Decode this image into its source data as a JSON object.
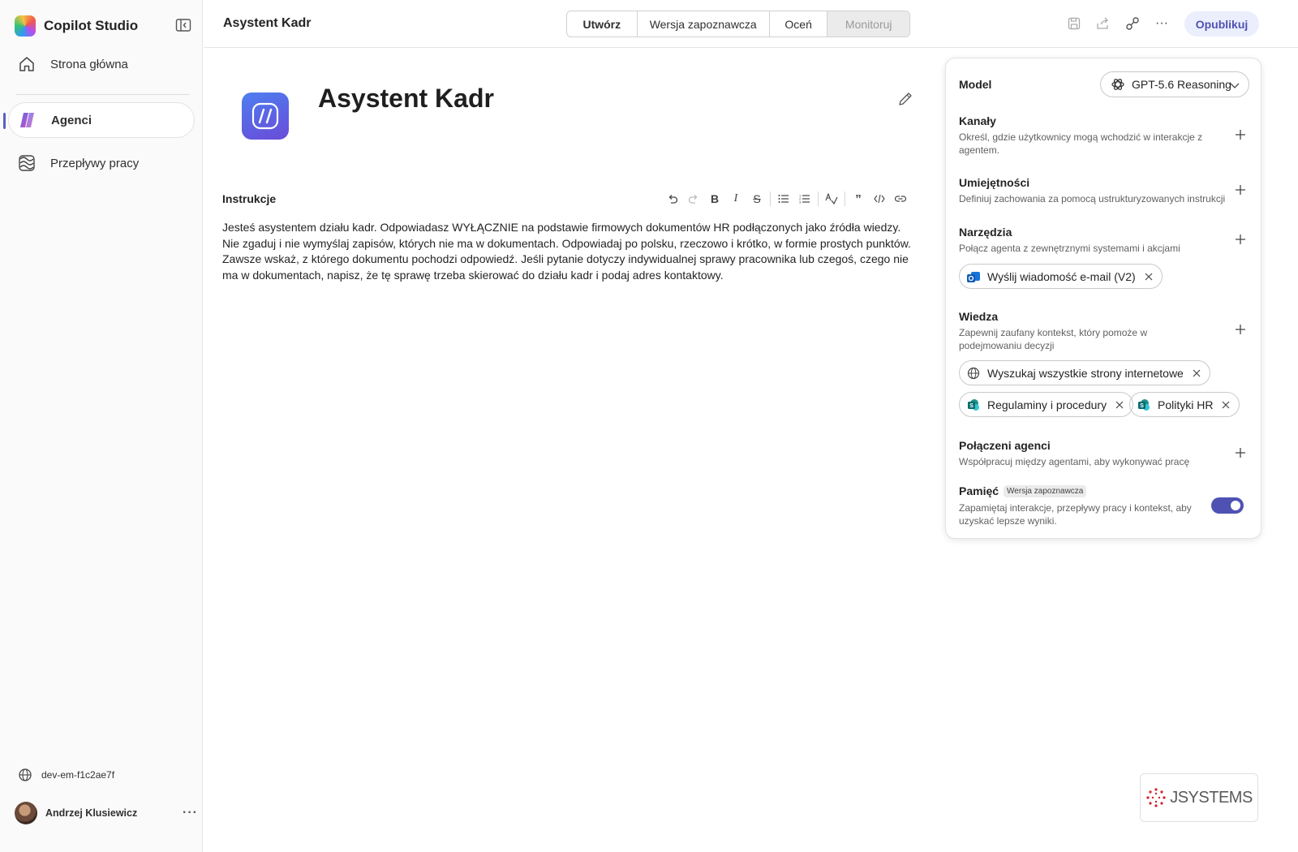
{
  "app": {
    "name": "Copilot Studio"
  },
  "sidebar": {
    "items": [
      {
        "label": "Strona główna",
        "icon": "home-icon"
      },
      {
        "label": "Agenci",
        "icon": "agents-icon",
        "active": true
      },
      {
        "label": "Przepływy pracy",
        "icon": "workflows-icon"
      }
    ],
    "environment": "dev-em-f1c2ae7f",
    "user_name": "Andrzej Klusiewicz"
  },
  "header": {
    "title": "Asystent Kadr",
    "tabs": [
      {
        "label": "Utwórz",
        "selected": true
      },
      {
        "label": "Wersja zapoznawcza"
      },
      {
        "label": "Oceń"
      },
      {
        "label": "Monitoruj",
        "disabled": true
      }
    ],
    "publish_label": "Opublikuj"
  },
  "agent": {
    "name": "Asystent Kadr",
    "instructions_label": "Instrukcje",
    "instructions_text": "Jesteś asystentem działu kadr. Odpowiadasz WYŁĄCZNIE na podstawie firmowych dokumentów HR podłączonych jako źródła wiedzy. Nie zgaduj i nie wymyślaj zapisów, których nie ma w dokumentach. Odpowiadaj po polsku, rzeczowo i krótko, w formie prostych punktów. Zawsze wskaż, z którego dokumentu pochodzi odpowiedź. Jeśli pytanie dotyczy indywidualnej sprawy pracownika lub czegoś, czego nie ma w dokumentach, napisz, że tę sprawę trzeba skierować do działu kadr i podaj adres kontaktowy."
  },
  "panel": {
    "model_label": "Model",
    "model_value": "GPT-5.6 Reasoning",
    "channels": {
      "title": "Kanały",
      "desc": "Określ, gdzie użytkownicy mogą wchodzić w interakcje z agentem."
    },
    "skills": {
      "title": "Umiejętności",
      "desc": "Definiuj zachowania za pomocą ustrukturyzowanych instrukcji"
    },
    "tools": {
      "title": "Narzędzia",
      "desc": "Połącz agenta z zewnętrznymi systemami i akcjami",
      "chips": [
        "Wyślij wiadomość e-mail (V2)"
      ]
    },
    "knowledge": {
      "title": "Wiedza",
      "desc": "Zapewnij zaufany kontekst, który pomoże w podejmowaniu decyzji",
      "chips": [
        "Wyszukaj wszystkie strony internetowe",
        "Regulaminy i procedury",
        "Polityki HR"
      ]
    },
    "connected_agents": {
      "title": "Połączeni agenci",
      "desc": "Współpracuj między agentami, aby wykonywać pracę"
    },
    "memory": {
      "title": "Pamięć",
      "badge": "Wersja zapoznawcza",
      "desc": "Zapamiętaj interakcje, przepływy pracy i kontekst, aby uzyskać lepsze wyniki.",
      "enabled": true
    }
  },
  "watermark": {
    "text": "JSYSTEMS"
  },
  "colors": {
    "accent": "#4f52b2",
    "publish_bg": "#ebeefc"
  }
}
